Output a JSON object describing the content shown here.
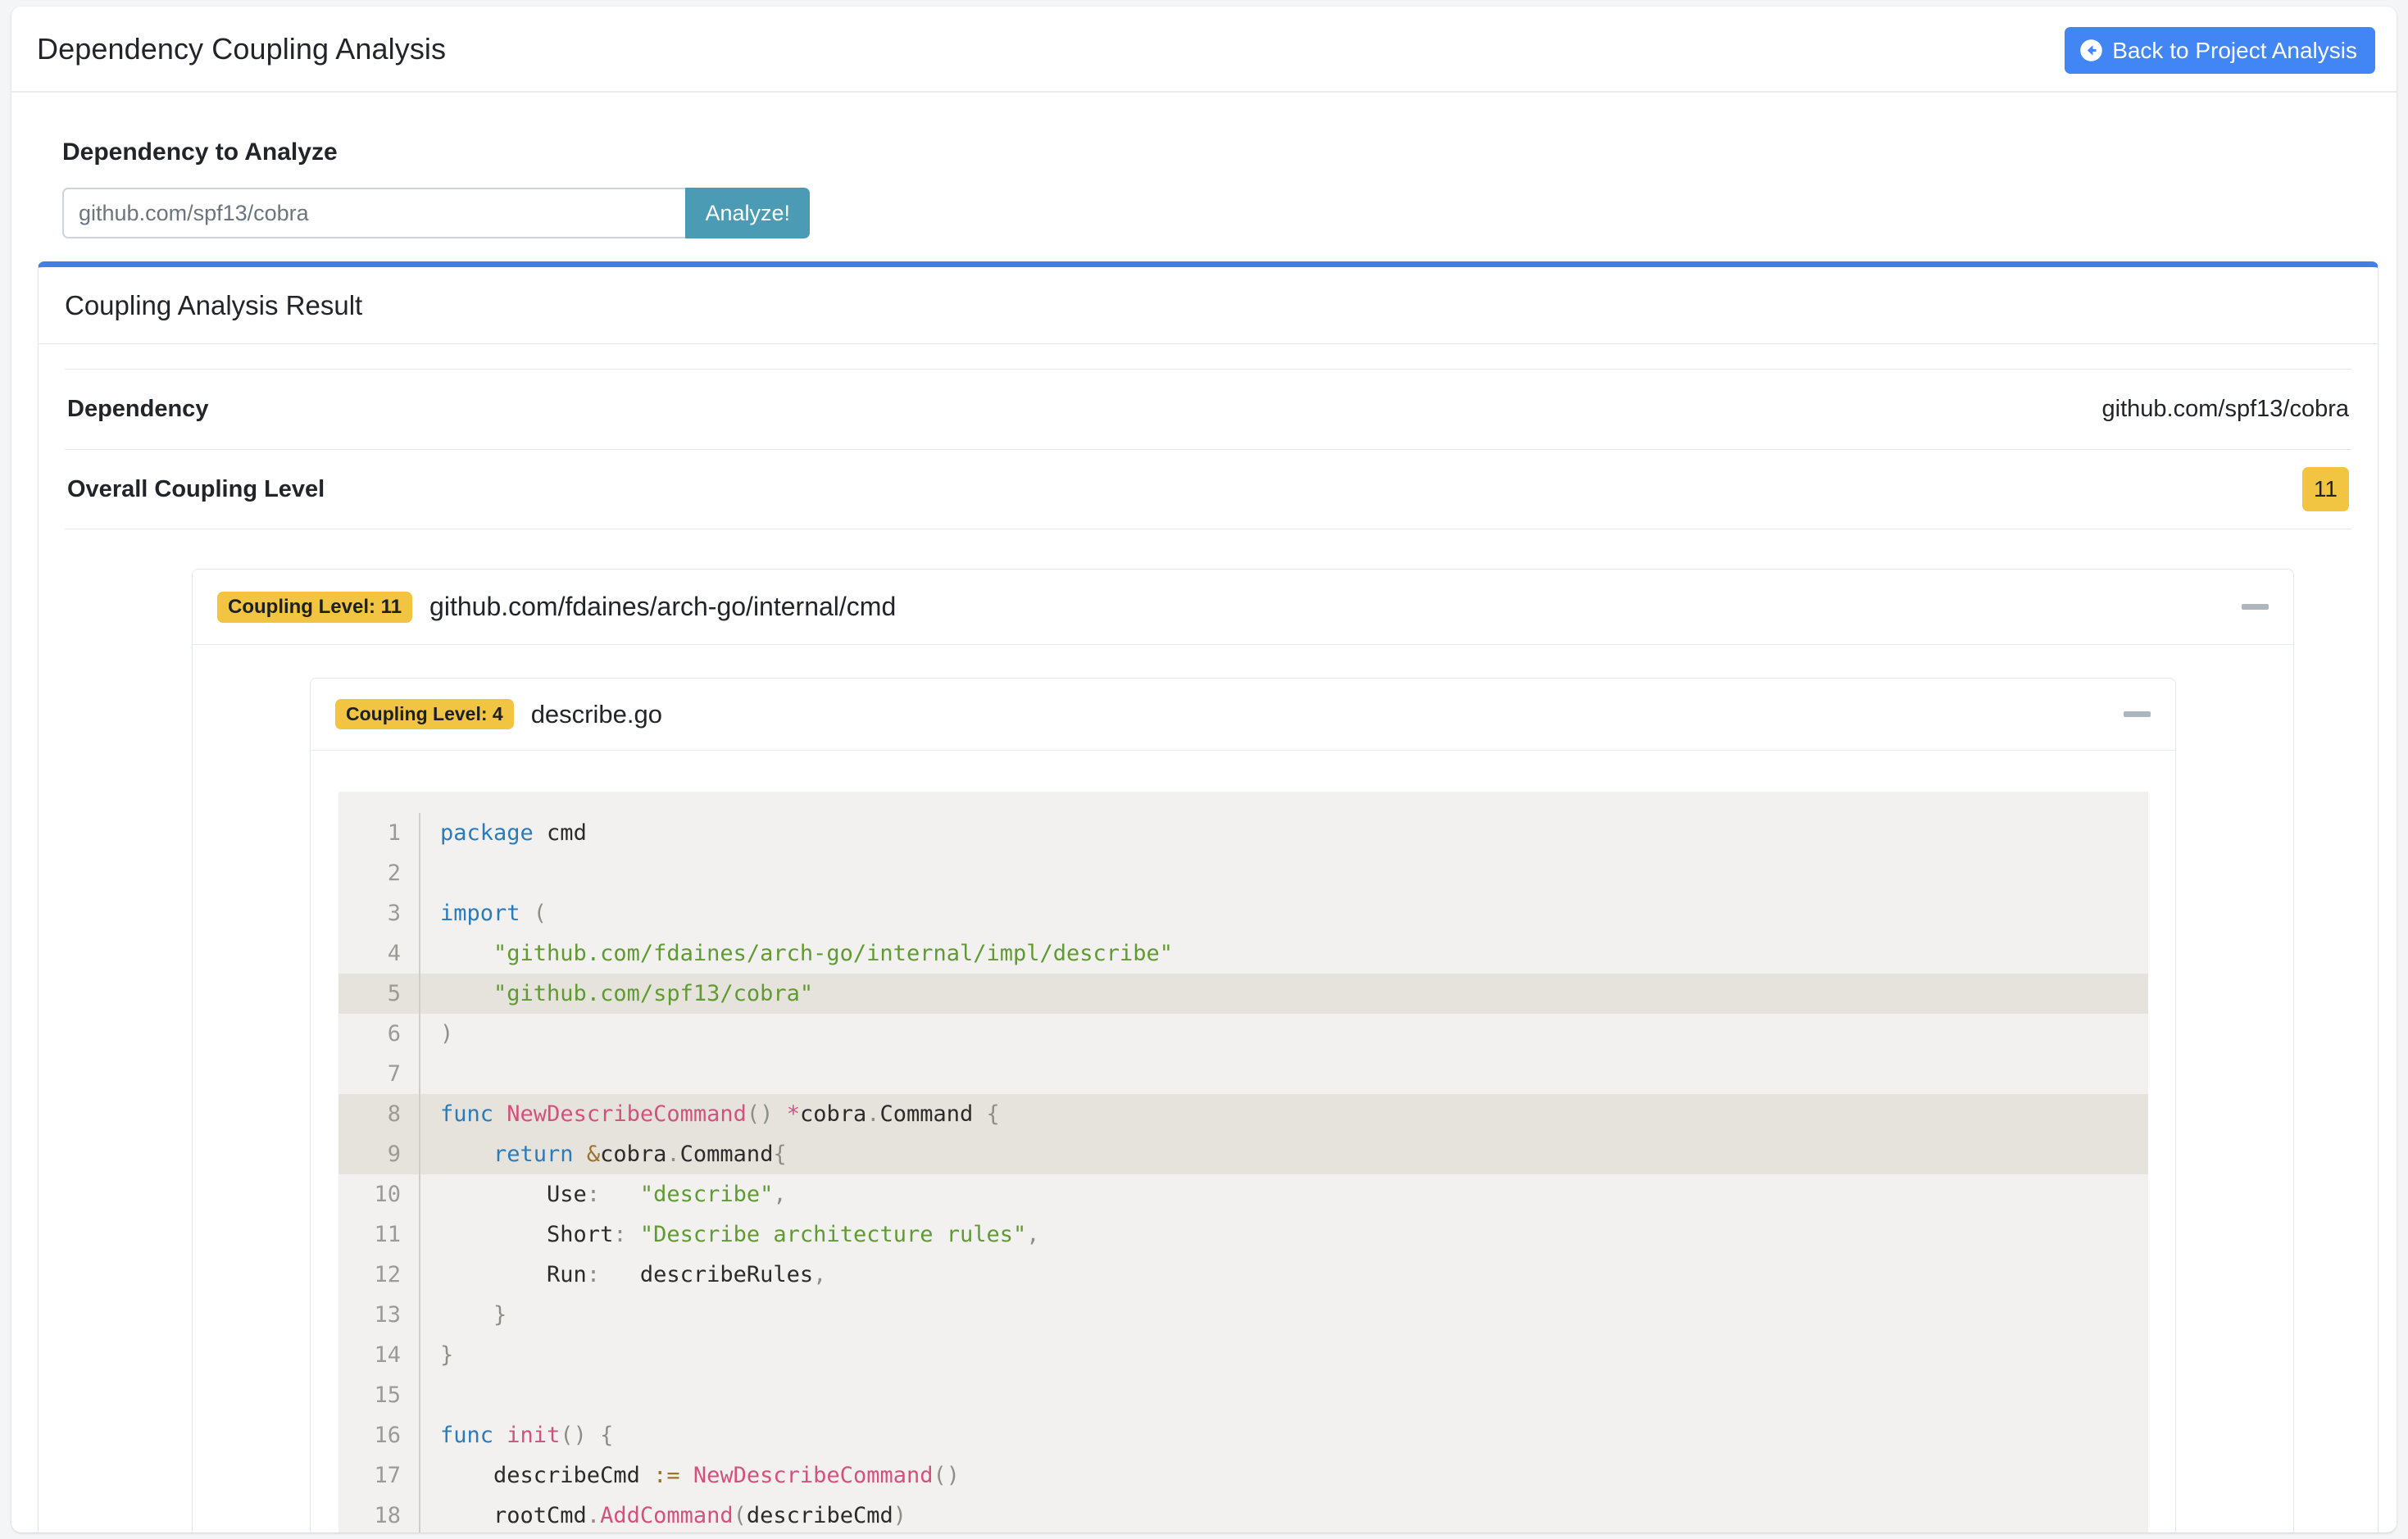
{
  "header": {
    "title": "Dependency Coupling Analysis",
    "back_button": "Back to Project Analysis",
    "back_icon": "arrow-circle-left-icon"
  },
  "form": {
    "label": "Dependency to Analyze",
    "input_value": "github.com/spf13/cobra",
    "input_placeholder": "github.com/spf13/cobra",
    "submit_label": "Analyze!"
  },
  "result": {
    "card_title": "Coupling Analysis Result",
    "rows": [
      {
        "label": "Dependency",
        "value": "github.com/spf13/cobra"
      },
      {
        "label": "Overall Coupling Level",
        "value": "11"
      }
    ],
    "overall_level": "11"
  },
  "package": {
    "badge": "Coupling Level: 11",
    "name": "github.com/fdaines/arch-go/internal/cmd",
    "collapse_icon": "minus-icon"
  },
  "file": {
    "badge": "Coupling Level: 4",
    "name": "describe.go",
    "collapse_icon": "minus-icon"
  },
  "code": {
    "lines": [
      {
        "n": "1",
        "hl": false,
        "tokens": [
          [
            "k",
            "package"
          ],
          [
            "ty",
            " cmd"
          ]
        ]
      },
      {
        "n": "2",
        "hl": false,
        "tokens": []
      },
      {
        "n": "3",
        "hl": false,
        "tokens": [
          [
            "k",
            "import"
          ],
          [
            "pu",
            " ("
          ]
        ]
      },
      {
        "n": "4",
        "hl": false,
        "tokens": [
          [
            "s",
            "    \"github.com/fdaines/arch-go/internal/impl/describe\""
          ]
        ]
      },
      {
        "n": "5",
        "hl": true,
        "tokens": [
          [
            "s",
            "    \"github.com/spf13/cobra\""
          ]
        ]
      },
      {
        "n": "6",
        "hl": false,
        "tokens": [
          [
            "pu",
            ")"
          ]
        ]
      },
      {
        "n": "7",
        "hl": false,
        "tokens": []
      },
      {
        "n": "8",
        "hl": true,
        "tokens": [
          [
            "k",
            "func"
          ],
          [
            "ty",
            " "
          ],
          [
            "fn",
            "NewDescribeCommand"
          ],
          [
            "pu",
            "()"
          ],
          [
            "ty",
            " "
          ],
          [
            "fn",
            "*"
          ],
          [
            "ty",
            "cobra"
          ],
          [
            "pu",
            "."
          ],
          [
            "ty",
            "Command"
          ],
          [
            "pu",
            " {"
          ]
        ]
      },
      {
        "n": "9",
        "hl": true,
        "tokens": [
          [
            "ty",
            "    "
          ],
          [
            "k",
            "return"
          ],
          [
            "ty",
            " "
          ],
          [
            "op",
            "&"
          ],
          [
            "ty",
            "cobra"
          ],
          [
            "pu",
            "."
          ],
          [
            "ty",
            "Command"
          ],
          [
            "pu",
            "{"
          ]
        ]
      },
      {
        "n": "10",
        "hl": false,
        "tokens": [
          [
            "ty",
            "        Use"
          ],
          [
            "pu",
            ":"
          ],
          [
            "ty",
            "   "
          ],
          [
            "s",
            "\"describe\""
          ],
          [
            "pu",
            ","
          ]
        ]
      },
      {
        "n": "11",
        "hl": false,
        "tokens": [
          [
            "ty",
            "        Short"
          ],
          [
            "pu",
            ":"
          ],
          [
            "ty",
            " "
          ],
          [
            "s",
            "\"Describe architecture rules\""
          ],
          [
            "pu",
            ","
          ]
        ]
      },
      {
        "n": "12",
        "hl": false,
        "tokens": [
          [
            "ty",
            "        Run"
          ],
          [
            "pu",
            ":"
          ],
          [
            "ty",
            "   describeRules"
          ],
          [
            "pu",
            ","
          ]
        ]
      },
      {
        "n": "13",
        "hl": false,
        "tokens": [
          [
            "pu",
            "    }"
          ]
        ]
      },
      {
        "n": "14",
        "hl": false,
        "tokens": [
          [
            "pu",
            "}"
          ]
        ]
      },
      {
        "n": "15",
        "hl": false,
        "tokens": []
      },
      {
        "n": "16",
        "hl": false,
        "tokens": [
          [
            "k",
            "func"
          ],
          [
            "ty",
            " "
          ],
          [
            "fn",
            "init"
          ],
          [
            "pu",
            "()"
          ],
          [
            "pu",
            " {"
          ]
        ]
      },
      {
        "n": "17",
        "hl": false,
        "tokens": [
          [
            "ty",
            "    describeCmd "
          ],
          [
            "op",
            ":="
          ],
          [
            "ty",
            " "
          ],
          [
            "fn",
            "NewDescribeCommand"
          ],
          [
            "pu",
            "()"
          ]
        ]
      },
      {
        "n": "18",
        "hl": false,
        "tokens": [
          [
            "ty",
            "    rootCmd"
          ],
          [
            "pu",
            "."
          ],
          [
            "fn",
            "AddCommand"
          ],
          [
            "pu",
            "("
          ],
          [
            "ty",
            "describeCmd"
          ],
          [
            "pu",
            ")"
          ]
        ]
      }
    ]
  },
  "colors": {
    "accent_blue": "#3f7fe8",
    "back_button_blue": "#4285f4",
    "analyze_teal": "#4a9bb3",
    "badge_yellow": "#f1c542",
    "code_bg": "#f2f1ef",
    "code_highlight": "#e6e3dd"
  }
}
